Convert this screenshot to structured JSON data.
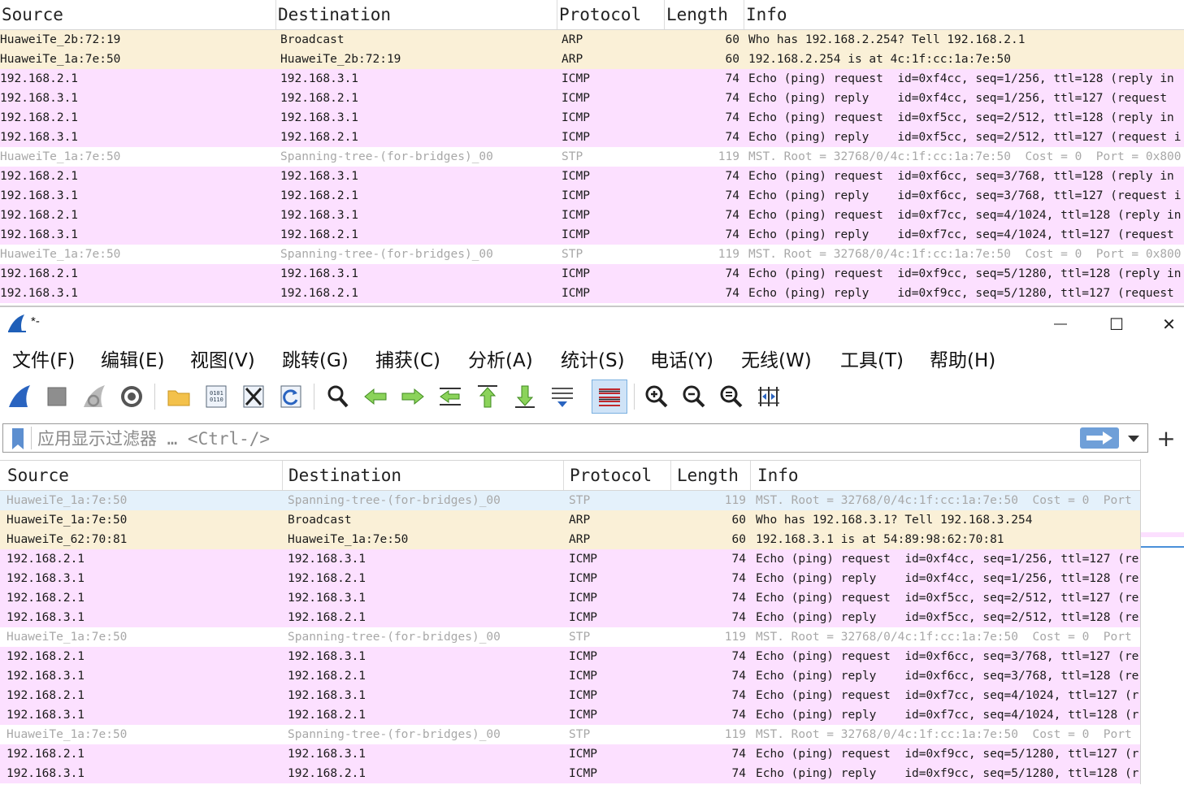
{
  "columns": [
    "Source",
    "Destination",
    "Protocol",
    "Length",
    "Info"
  ],
  "top_list": {
    "rows": [
      {
        "type": "arp",
        "source": "HuaweiTe_2b:72:19",
        "destination": "Broadcast",
        "protocol": "ARP",
        "length": "60",
        "info": "Who has 192.168.2.254? Tell 192.168.2.1"
      },
      {
        "type": "arp",
        "source": "HuaweiTe_1a:7e:50",
        "destination": "HuaweiTe_2b:72:19",
        "protocol": "ARP",
        "length": "60",
        "info": "192.168.2.254 is at 4c:1f:cc:1a:7e:50"
      },
      {
        "type": "icmp",
        "source": "192.168.2.1",
        "destination": "192.168.3.1",
        "protocol": "ICMP",
        "length": "74",
        "info": "Echo (ping) request  id=0xf4cc, seq=1/256, ttl=128 (reply in"
      },
      {
        "type": "icmp",
        "source": "192.168.3.1",
        "destination": "192.168.2.1",
        "protocol": "ICMP",
        "length": "74",
        "info": "Echo (ping) reply    id=0xf4cc, seq=1/256, ttl=127 (request"
      },
      {
        "type": "icmp",
        "source": "192.168.2.1",
        "destination": "192.168.3.1",
        "protocol": "ICMP",
        "length": "74",
        "info": "Echo (ping) request  id=0xf5cc, seq=2/512, ttl=128 (reply in"
      },
      {
        "type": "icmp",
        "source": "192.168.3.1",
        "destination": "192.168.2.1",
        "protocol": "ICMP",
        "length": "74",
        "info": "Echo (ping) reply    id=0xf5cc, seq=2/512, ttl=127 (request i"
      },
      {
        "type": "stp",
        "source": "HuaweiTe_1a:7e:50",
        "destination": "Spanning-tree-(for-bridges)_00",
        "protocol": "STP",
        "length": "119",
        "info": "MST. Root = 32768/0/4c:1f:cc:1a:7e:50  Cost = 0  Port = 0x800"
      },
      {
        "type": "icmp",
        "source": "192.168.2.1",
        "destination": "192.168.3.1",
        "protocol": "ICMP",
        "length": "74",
        "info": "Echo (ping) request  id=0xf6cc, seq=3/768, ttl=128 (reply in"
      },
      {
        "type": "icmp",
        "source": "192.168.3.1",
        "destination": "192.168.2.1",
        "protocol": "ICMP",
        "length": "74",
        "info": "Echo (ping) reply    id=0xf6cc, seq=3/768, ttl=127 (request i"
      },
      {
        "type": "icmp",
        "source": "192.168.2.1",
        "destination": "192.168.3.1",
        "protocol": "ICMP",
        "length": "74",
        "info": "Echo (ping) request  id=0xf7cc, seq=4/1024, ttl=128 (reply in"
      },
      {
        "type": "icmp",
        "source": "192.168.3.1",
        "destination": "192.168.2.1",
        "protocol": "ICMP",
        "length": "74",
        "info": "Echo (ping) reply    id=0xf7cc, seq=4/1024, ttl=127 (request"
      },
      {
        "type": "stp",
        "source": "HuaweiTe_1a:7e:50",
        "destination": "Spanning-tree-(for-bridges)_00",
        "protocol": "STP",
        "length": "119",
        "info": "MST. Root = 32768/0/4c:1f:cc:1a:7e:50  Cost = 0  Port = 0x800"
      },
      {
        "type": "icmp",
        "source": "192.168.2.1",
        "destination": "192.168.3.1",
        "protocol": "ICMP",
        "length": "74",
        "info": "Echo (ping) request  id=0xf9cc, seq=5/1280, ttl=128 (reply in"
      },
      {
        "type": "icmp",
        "source": "192.168.3.1",
        "destination": "192.168.2.1",
        "protocol": "ICMP",
        "length": "74",
        "info": "Echo (ping) reply    id=0xf9cc, seq=5/1280, ttl=127 (request"
      }
    ]
  },
  "window": {
    "title": "*-",
    "minimize_glyph": "—",
    "maximize_glyph": "☐",
    "close_glyph": "✕"
  },
  "menu": [
    "文件(F)",
    "编辑(E)",
    "视图(V)",
    "跳转(G)",
    "捕获(C)",
    "分析(A)",
    "统计(S)",
    "电话(Y)",
    "无线(W)",
    "工具(T)",
    "帮助(H)"
  ],
  "toolbar_icons": [
    "start-capture-icon",
    "stop-capture-icon",
    "restart-capture-icon",
    "capture-options-icon",
    "open-file-icon",
    "save-file-icon",
    "close-file-icon",
    "reload-file-icon",
    "find-packet-icon",
    "go-back-icon",
    "go-forward-icon",
    "go-to-packet-icon",
    "first-packet-icon",
    "last-packet-icon",
    "autoscroll-icon",
    "colorize-icon",
    "zoom-in-icon",
    "zoom-out-icon",
    "normal-size-icon",
    "resize-columns-icon"
  ],
  "filter": {
    "placeholder": "应用显示过滤器 … <Ctrl-/>",
    "value": "",
    "add_glyph": "+"
  },
  "bottom_list": {
    "rows": [
      {
        "type": "stp sel",
        "source": "HuaweiTe_1a:7e:50",
        "destination": "Spanning-tree-(for-bridges)_00",
        "protocol": "STP",
        "length": "119",
        "info": "MST. Root = 32768/0/4c:1f:cc:1a:7e:50  Cost = 0  Port"
      },
      {
        "type": "arp",
        "source": "HuaweiTe_1a:7e:50",
        "destination": "Broadcast",
        "protocol": "ARP",
        "length": "60",
        "info": "Who has 192.168.3.1? Tell 192.168.3.254"
      },
      {
        "type": "arp",
        "source": "HuaweiTe_62:70:81",
        "destination": "HuaweiTe_1a:7e:50",
        "protocol": "ARP",
        "length": "60",
        "info": "192.168.3.1 is at 54:89:98:62:70:81"
      },
      {
        "type": "icmp",
        "source": "192.168.2.1",
        "destination": "192.168.3.1",
        "protocol": "ICMP",
        "length": "74",
        "info": "Echo (ping) request  id=0xf4cc, seq=1/256, ttl=127 (re"
      },
      {
        "type": "icmp",
        "source": "192.168.3.1",
        "destination": "192.168.2.1",
        "protocol": "ICMP",
        "length": "74",
        "info": "Echo (ping) reply    id=0xf4cc, seq=1/256, ttl=128 (re"
      },
      {
        "type": "icmp",
        "source": "192.168.2.1",
        "destination": "192.168.3.1",
        "protocol": "ICMP",
        "length": "74",
        "info": "Echo (ping) request  id=0xf5cc, seq=2/512, ttl=127 (re"
      },
      {
        "type": "icmp",
        "source": "192.168.3.1",
        "destination": "192.168.2.1",
        "protocol": "ICMP",
        "length": "74",
        "info": "Echo (ping) reply    id=0xf5cc, seq=2/512, ttl=128 (re"
      },
      {
        "type": "stp",
        "source": "HuaweiTe_1a:7e:50",
        "destination": "Spanning-tree-(for-bridges)_00",
        "protocol": "STP",
        "length": "119",
        "info": "MST. Root = 32768/0/4c:1f:cc:1a:7e:50  Cost = 0  Port"
      },
      {
        "type": "icmp",
        "source": "192.168.2.1",
        "destination": "192.168.3.1",
        "protocol": "ICMP",
        "length": "74",
        "info": "Echo (ping) request  id=0xf6cc, seq=3/768, ttl=127 (re"
      },
      {
        "type": "icmp",
        "source": "192.168.3.1",
        "destination": "192.168.2.1",
        "protocol": "ICMP",
        "length": "74",
        "info": "Echo (ping) reply    id=0xf6cc, seq=3/768, ttl=128 (re"
      },
      {
        "type": "icmp",
        "source": "192.168.2.1",
        "destination": "192.168.3.1",
        "protocol": "ICMP",
        "length": "74",
        "info": "Echo (ping) request  id=0xf7cc, seq=4/1024, ttl=127 (r"
      },
      {
        "type": "icmp",
        "source": "192.168.3.1",
        "destination": "192.168.2.1",
        "protocol": "ICMP",
        "length": "74",
        "info": "Echo (ping) reply    id=0xf7cc, seq=4/1024, ttl=128 (r"
      },
      {
        "type": "stp",
        "source": "HuaweiTe_1a:7e:50",
        "destination": "Spanning-tree-(for-bridges)_00",
        "protocol": "STP",
        "length": "119",
        "info": "MST. Root = 32768/0/4c:1f:cc:1a:7e:50  Cost = 0  Port"
      },
      {
        "type": "icmp",
        "source": "192.168.2.1",
        "destination": "192.168.3.1",
        "protocol": "ICMP",
        "length": "74",
        "info": "Echo (ping) request  id=0xf9cc, seq=5/1280, ttl=127 (r"
      },
      {
        "type": "icmp",
        "source": "192.168.3.1",
        "destination": "192.168.2.1",
        "protocol": "ICMP",
        "length": "74",
        "info": "Echo (ping) reply    id=0xf9cc, seq=5/1280, ttl=128 (r"
      }
    ]
  },
  "colors": {
    "arp_row": "#faf0d7",
    "icmp_row": "#fce0ff",
    "stp_text": "#a8a8a8",
    "selected_row": "#e4f1fb",
    "apply_button": "#6f9fd8"
  }
}
